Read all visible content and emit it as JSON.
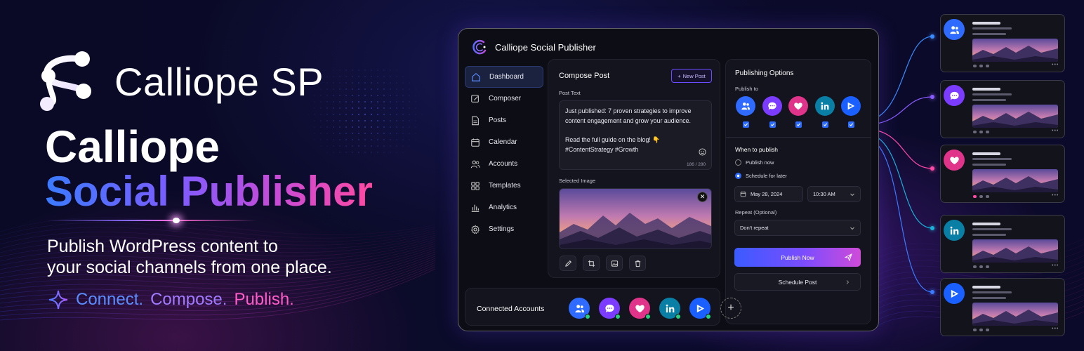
{
  "hero": {
    "brand": "Calliope SP",
    "title_line1": "Calliope",
    "title_line2": "Social Publisher",
    "tagline_line1": "Publish WordPress content to",
    "tagline_line2": "your social channels from one place.",
    "slogan": [
      "Connect.",
      "Compose.",
      "Publish."
    ]
  },
  "window": {
    "title": "Calliope Social Publisher"
  },
  "sidebar": {
    "items": [
      {
        "label": "Dashboard",
        "icon": "home-icon",
        "active": true
      },
      {
        "label": "Composer",
        "icon": "compose-icon",
        "active": false
      },
      {
        "label": "Posts",
        "icon": "document-icon",
        "active": false
      },
      {
        "label": "Calendar",
        "icon": "calendar-icon",
        "active": false
      },
      {
        "label": "Accounts",
        "icon": "users-icon",
        "active": false
      },
      {
        "label": "Templates",
        "icon": "grid-icon",
        "active": false
      },
      {
        "label": "Analytics",
        "icon": "bar-chart-icon",
        "active": false
      },
      {
        "label": "Settings",
        "icon": "gear-icon",
        "active": false
      }
    ]
  },
  "compose": {
    "title": "Compose Post",
    "new_post_label": "New Post",
    "post_text_label": "Post Text",
    "post_text_line1": "Just published: 7 proven strategies to improve",
    "post_text_line2": "content engagement and grow your audience.",
    "post_text_line3": "Read the full guide on the blog! 👇",
    "post_text_line4": "#ContentStrategy #Growth",
    "char_count": "186 / 280",
    "selected_image_label": "Selected Image"
  },
  "options": {
    "title": "Publishing Options",
    "publish_to_label": "Publish to",
    "networks": [
      {
        "name": "groups",
        "icon": "users-icon",
        "color": "#2f6bff",
        "checked": true
      },
      {
        "name": "messenger",
        "icon": "chat-bubble-icon",
        "color": "#7b3cff",
        "checked": true
      },
      {
        "name": "favorites",
        "icon": "heart-icon",
        "color": "#e0338a",
        "checked": true
      },
      {
        "name": "linkedin",
        "icon": "linkedin-icon",
        "color": "#0a7fa6",
        "checked": true
      },
      {
        "name": "video",
        "icon": "play-icon",
        "color": "#1a5fff",
        "checked": true
      }
    ],
    "when_label": "When to publish",
    "publish_now_label": "Publish now",
    "schedule_later_label": "Schedule for later",
    "date_value": "May 28, 2024",
    "time_value": "10:30 AM",
    "repeat_label": "Repeat (Optional)",
    "repeat_value": "Don't repeat",
    "publish_now_button": "Publish Now",
    "schedule_post_button": "Schedule Post"
  },
  "connected": {
    "label": "Connected Accounts",
    "accounts": [
      {
        "icon": "users-icon",
        "color": "#2f6bff"
      },
      {
        "icon": "chat-bubble-icon",
        "color": "#7b3cff"
      },
      {
        "icon": "heart-icon",
        "color": "#e0338a"
      },
      {
        "icon": "linkedin-icon",
        "color": "#0a7fa6"
      },
      {
        "icon": "play-icon",
        "color": "#1a5fff"
      }
    ],
    "add_label": "+"
  },
  "preview_cards": [
    {
      "icon": "users-icon",
      "color": "#2f6bff",
      "accent": "#3a8bff"
    },
    {
      "icon": "chat-bubble-icon",
      "color": "#7b3cff",
      "accent": "#8a5bff"
    },
    {
      "icon": "heart-icon",
      "color": "#e0338a",
      "accent": "#ff4aa8"
    },
    {
      "icon": "linkedin-icon",
      "color": "#0a7fa6",
      "accent": "#1ab0d8"
    },
    {
      "icon": "play-icon",
      "color": "#1a5fff",
      "accent": "#3a7bff"
    }
  ]
}
